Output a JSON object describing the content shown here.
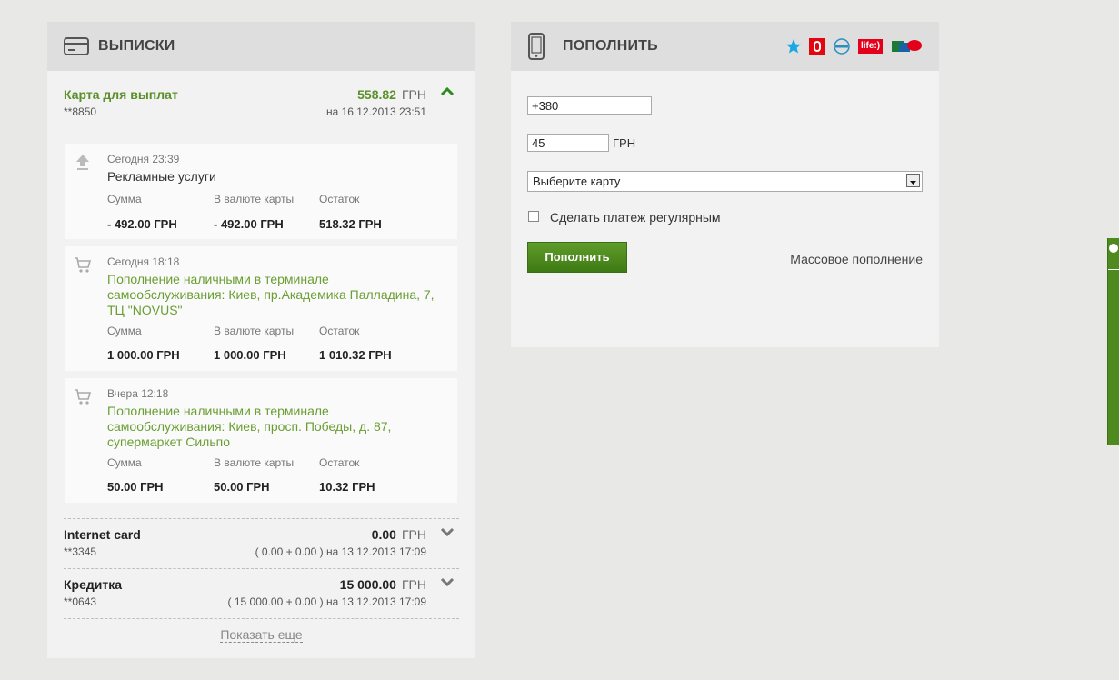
{
  "statements": {
    "title": "ВЫПИСКИ",
    "active_card": {
      "name": "Карта для выплат",
      "number": "**8850",
      "amount": "558.82",
      "currency": "ГРН",
      "date": "на 16.12.2013 23:51"
    },
    "columns": {
      "sum": "Сумма",
      "card_currency": "В валюте карты",
      "balance": "Остаток"
    },
    "transactions": [
      {
        "icon": "upload-icon",
        "time": "Сегодня 23:39",
        "description": "Рекламные услуги",
        "sum": "- 492.00 ГРН",
        "card_currency": "- 492.00 ГРН",
        "balance": "518.32 ГРН"
      },
      {
        "icon": "cart-icon",
        "time": "Сегодня 18:18",
        "description": "Пополнение наличными в терминале самообслуживания: Киев, пр.Академика Палладина, 7, ТЦ \"NOVUS\"",
        "sum": "1 000.00 ГРН",
        "card_currency": "1 000.00 ГРН",
        "balance": "1 010.32 ГРН"
      },
      {
        "icon": "cart-icon",
        "time": "Вчера 12:18",
        "description": "Пополнение наличными в терминале самообслуживания: Киев, просп. Победы, д. 87, супермаркет Сильпо",
        "sum": "50.00 ГРН",
        "card_currency": "50.00 ГРН",
        "balance": "10.32 ГРН"
      }
    ],
    "other_cards": [
      {
        "name": "Internet card",
        "number": "**3345",
        "amount": "0.00",
        "currency": "ГРН",
        "date": "( 0.00 + 0.00 ) на 13.12.2013 17:09"
      },
      {
        "name": "Кредитка",
        "number": "**0643",
        "amount": "15 000.00",
        "currency": "ГРН",
        "date": "( 15 000.00 + 0.00 ) на 13.12.2013 17:09"
      }
    ],
    "show_more": "Показать еще"
  },
  "topup": {
    "title": "ПОПОЛНИТЬ",
    "operators": [
      "kyivstar-logo",
      "mts-logo",
      "utel-logo",
      "life-logo",
      "beeline-logo"
    ],
    "life_label": "life:)",
    "phone_value": "+380",
    "amount_value": "45",
    "amount_currency": "ГРН",
    "card_select": "Выберите карту",
    "regular_label": "Сделать платеж регулярным",
    "submit_label": "Пополнить",
    "mass_link": "Массовое пополнение"
  },
  "colors": {
    "brand_green": "#5b8f2a",
    "link_green": "#6a9e32",
    "button_green": "#4f8a1f"
  }
}
